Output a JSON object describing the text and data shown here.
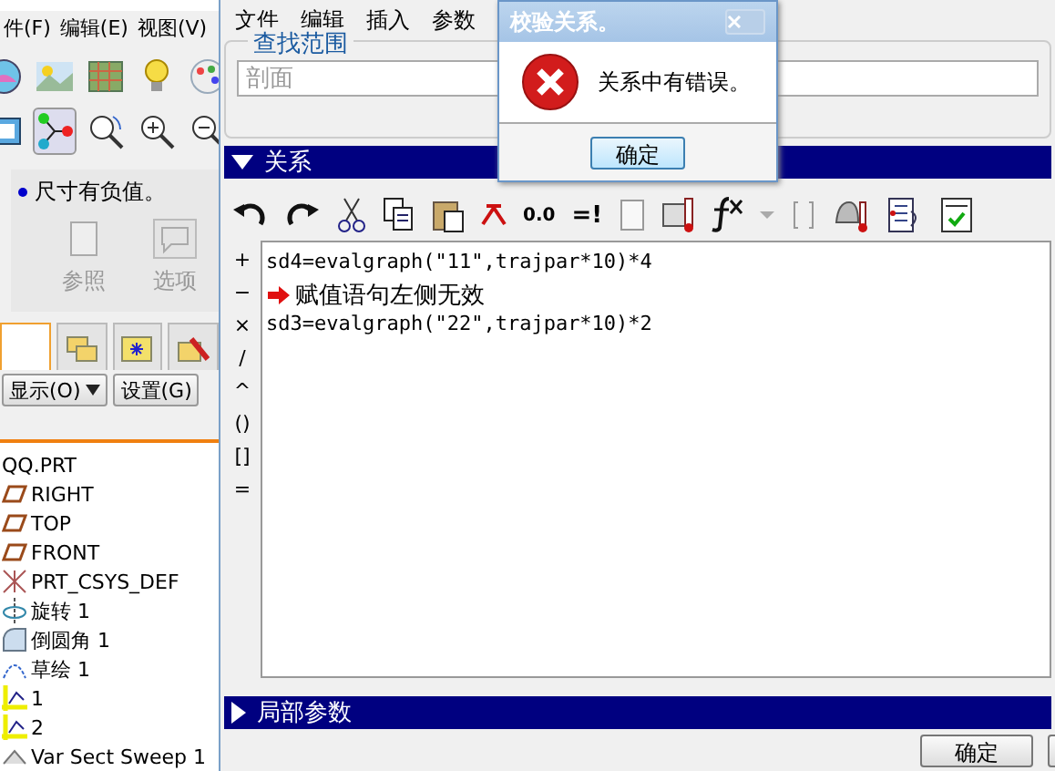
{
  "left_panel": {
    "menu": [
      "件(F)",
      "编辑(E)",
      "视图(V)"
    ],
    "toolbar_rows": [
      [
        {
          "kind": "shade",
          "pressed": false
        },
        {
          "kind": "scene",
          "pressed": false
        },
        {
          "kind": "texture",
          "pressed": false
        },
        {
          "kind": "bulb",
          "pressed": false
        },
        {
          "kind": "palette",
          "pressed": false
        }
      ],
      [
        {
          "kind": "view",
          "pressed": false
        },
        {
          "kind": "nodes",
          "pressed": true
        },
        {
          "kind": "spin",
          "pressed": false
        },
        {
          "kind": "zoom-in",
          "pressed": false
        },
        {
          "kind": "zoom-out",
          "pressed": false
        }
      ]
    ],
    "message": "尺寸有负值。",
    "actions": [
      {
        "kind": "ref",
        "label": "参照",
        "disabled": true
      },
      {
        "kind": "options",
        "label": "选项",
        "disabled": true
      }
    ],
    "tabs": [
      {
        "kind": "blank",
        "selected": true
      },
      {
        "kind": "folders",
        "selected": false
      },
      {
        "kind": "star",
        "selected": false
      },
      {
        "kind": "tools",
        "selected": false
      }
    ],
    "show_button": "显示(O)",
    "settings_button": "设置(G)",
    "tree": [
      {
        "kind": "part",
        "label": "QQ.PRT"
      },
      {
        "kind": "plane",
        "label": "RIGHT"
      },
      {
        "kind": "plane",
        "label": "TOP"
      },
      {
        "kind": "plane",
        "label": "FRONT"
      },
      {
        "kind": "csys",
        "label": "PRT_CSYS_DEF"
      },
      {
        "kind": "revolve",
        "label": "旋转 1"
      },
      {
        "kind": "round",
        "label": "倒圆角 1"
      },
      {
        "kind": "sketch",
        "label": "草绘 1"
      },
      {
        "kind": "curve",
        "label": "1"
      },
      {
        "kind": "curve",
        "label": "2"
      },
      {
        "kind": "sweep",
        "label": "Var Sect Sweep 1"
      }
    ]
  },
  "relations_window": {
    "menu": [
      "文件",
      "编辑",
      "插入",
      "参数"
    ],
    "scope": {
      "title": "查找范围",
      "placeholder": "剖面"
    },
    "section": {
      "title": "关系",
      "expanded": true
    },
    "toolbar": [
      {
        "kind": "undo"
      },
      {
        "kind": "redo"
      },
      {
        "kind": "cut"
      },
      {
        "kind": "copy"
      },
      {
        "kind": "paste"
      },
      {
        "kind": "delete"
      },
      {
        "kind": "decimal",
        "text": "0.0"
      },
      {
        "kind": "eq",
        "text": "=!"
      },
      {
        "kind": "box"
      },
      {
        "kind": "thermo"
      },
      {
        "kind": "fx"
      },
      {
        "kind": "caret"
      },
      {
        "kind": "brackets"
      },
      {
        "kind": "bell"
      },
      {
        "kind": "list"
      },
      {
        "kind": "check"
      }
    ],
    "operators": [
      "+",
      "−",
      "×",
      "/",
      "^",
      "()",
      "[]",
      "="
    ],
    "lines": [
      {
        "kind": "code",
        "text": "sd4=evalgraph(\"11\",trajpar*10)*4"
      },
      {
        "kind": "error",
        "text": "赋值语句左侧无效"
      },
      {
        "kind": "code",
        "text": "sd3=evalgraph(\"22\",trajpar*10)*2"
      }
    ],
    "local_params": {
      "title": "局部参数",
      "expanded": false
    },
    "buttons": [
      "确定"
    ]
  },
  "dialog": {
    "title": "校验关系。",
    "message": "关系中有错误。",
    "button": "确定"
  }
}
